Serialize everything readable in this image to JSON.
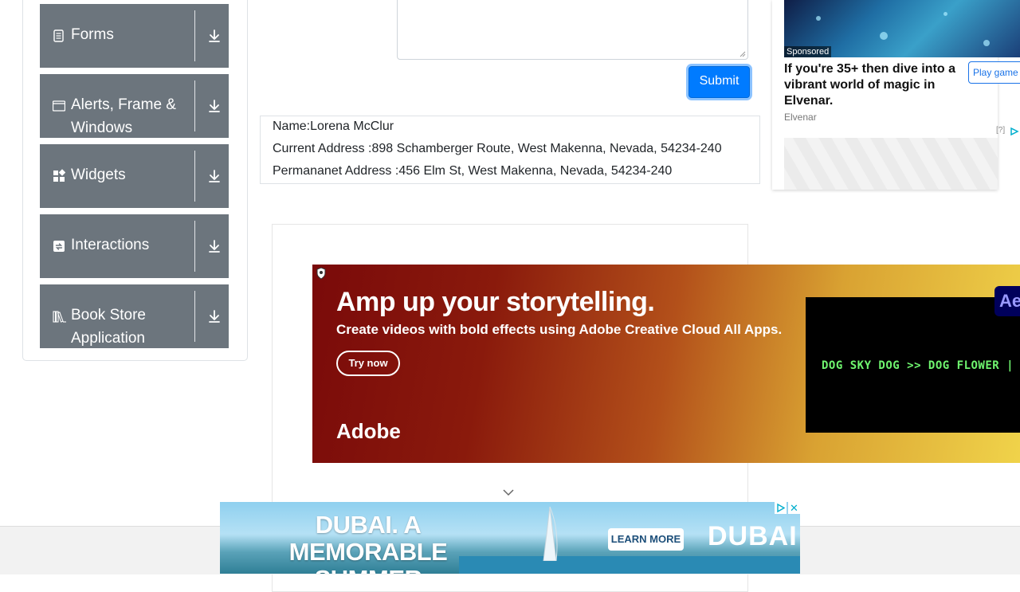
{
  "sidebar": {
    "groups": [
      {
        "label": "Forms",
        "icon": "forms-icon"
      },
      {
        "label": "Alerts, Frame & Windows",
        "icon": "window-icon"
      },
      {
        "label": "Widgets",
        "icon": "widgets-icon"
      },
      {
        "label": "Interactions",
        "icon": "interactions-icon"
      },
      {
        "label": "Book Store Application",
        "icon": "books-icon"
      }
    ]
  },
  "form": {
    "submit_label": "Submit"
  },
  "output": {
    "name": "Name:Lorena McClur",
    "current_address": "Current Address :898 Schamberger Route, West Makenna, Nevada, 54234-240",
    "permanent_address": "Permananet Address :456 Elm St, West Makenna, Nevada, 54234-240"
  },
  "side_ad": {
    "sponsored": "Sponsored",
    "headline": "If you're 35+ then dive into a vibrant world of magic in Elvenar.",
    "brand": "Elvenar",
    "cta": "Play game",
    "help": "[?]"
  },
  "adobe_ad": {
    "headline": "Amp up your storytelling.",
    "subline": "Create videos with bold effects using Adobe Creative Cloud All Apps.",
    "cta": "Try now",
    "logo": "Adobe",
    "ticker": "DOG SKY DOG >> DOG FLOWER |",
    "badge": "Ae"
  },
  "dubai_ad": {
    "headline": "DUBAI. A MEMORABLE SUMMER VACATION",
    "cta": "LEARN MORE",
    "logo": "DUBAI",
    "close": "✕"
  },
  "colors": {
    "primary": "#007bff",
    "sidebar_group": "#6c757d"
  }
}
